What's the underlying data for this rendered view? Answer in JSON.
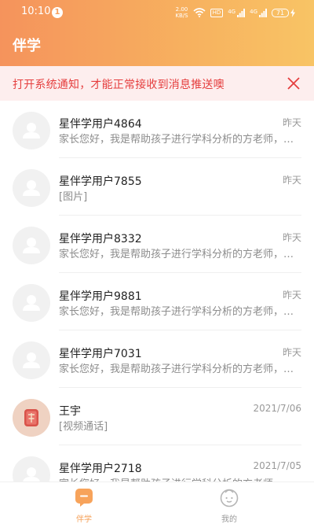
{
  "status_bar": {
    "time": "10:10",
    "notification_count": "1",
    "net_speed_value": "2.00",
    "net_speed_unit": "KB/S",
    "hd_badge": "HD",
    "signal1_label": "4G",
    "signal2_label": "4G",
    "battery_level": "71"
  },
  "header": {
    "title": "伴学"
  },
  "notice": {
    "text": "打开系统通知，才能正常接收到消息推送噢"
  },
  "conversations": [
    {
      "name": "星伴学用户4864",
      "time": "昨天",
      "message": "家长您好，我是帮助孩子进行学科分析的方老师，有什么问题可以随时问我"
    },
    {
      "name": "星伴学用户7855",
      "time": "昨天",
      "message": "[图片]"
    },
    {
      "name": "星伴学用户8332",
      "time": "昨天",
      "message": "家长您好，我是帮助孩子进行学科分析的方老师，有什么问题可以随时问我"
    },
    {
      "name": "星伴学用户9881",
      "time": "昨天",
      "message": "家长您好，我是帮助孩子进行学科分析的方老师，有什么问题可以随时问我"
    },
    {
      "name": "星伴学用户7031",
      "time": "昨天",
      "message": "家长您好，我是帮助孩子进行学科分析的方老师，有什么问题可以随时问我"
    },
    {
      "name": "王宇",
      "time": "2021/7/06",
      "message": "[视频通话]"
    },
    {
      "name": "星伴学用户2718",
      "time": "2021/7/05",
      "message": "家长您好，我是帮助孩子进行学科分析的方老师，有什么问题可以随时问我"
    }
  ],
  "tabbar": {
    "home_label": "伴学",
    "mine_label": "我的"
  },
  "colors": {
    "header_start": "#f5935c",
    "header_end": "#f8c465",
    "notice_text": "#e53e3e",
    "notice_bg": "#fdeeee",
    "active_tab": "#f5a15a"
  }
}
